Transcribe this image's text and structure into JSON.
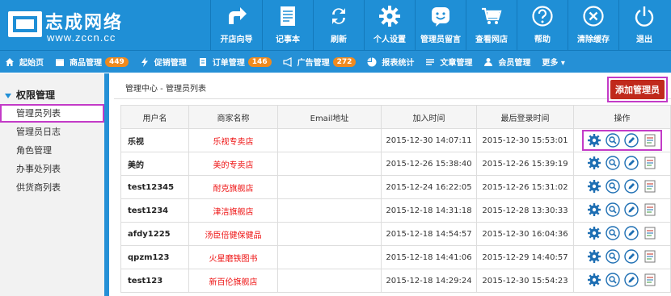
{
  "brand": {
    "title": "志成网络",
    "url": "www.zccn.cc"
  },
  "topnav": [
    {
      "label": "开店向导",
      "icon": "arrow-forward-icon"
    },
    {
      "label": "记事本",
      "icon": "notepad-icon"
    },
    {
      "label": "刷新",
      "icon": "refresh-icon"
    },
    {
      "label": "个人设置",
      "icon": "gear-icon"
    },
    {
      "label": "管理员留言",
      "icon": "smiley-chat-icon"
    },
    {
      "label": "查看网店",
      "icon": "cart-icon"
    },
    {
      "label": "帮助",
      "icon": "help-icon"
    },
    {
      "label": "清除缓存",
      "icon": "clear-icon"
    },
    {
      "label": "退出",
      "icon": "power-icon"
    }
  ],
  "subnav": [
    {
      "label": "起始页",
      "icon": "home-icon",
      "badge": ""
    },
    {
      "label": "商品管理",
      "icon": "box-icon",
      "badge": "449"
    },
    {
      "label": "促销管理",
      "icon": "lightning-icon",
      "badge": ""
    },
    {
      "label": "订单管理",
      "icon": "order-icon",
      "badge": "146"
    },
    {
      "label": "广告管理",
      "icon": "megaphone-icon",
      "badge": "272"
    },
    {
      "label": "报表统计",
      "icon": "pie-icon",
      "badge": ""
    },
    {
      "label": "文章管理",
      "icon": "list-icon",
      "badge": ""
    },
    {
      "label": "会员管理",
      "icon": "user-icon",
      "badge": ""
    },
    {
      "label": "更多 ▾",
      "icon": "",
      "badge": ""
    }
  ],
  "sidebar": {
    "heading": "权限管理",
    "items": [
      {
        "label": "管理员列表",
        "active": true
      },
      {
        "label": "管理员日志",
        "active": false
      },
      {
        "label": "角色管理",
        "active": false
      },
      {
        "label": "办事处列表",
        "active": false
      },
      {
        "label": "供货商列表",
        "active": false
      }
    ]
  },
  "breadcrumb": "管理中心 - 管理员列表",
  "add_button": "添加管理员",
  "table": {
    "headers": [
      "用户名",
      "商家名称",
      "Email地址",
      "加入时间",
      "最后登录时间",
      "操作"
    ],
    "rows": [
      {
        "user": "乐视",
        "shop": "乐视专卖店",
        "email": "",
        "joined": "2015-12-30 14:07:11",
        "last": "2015-12-30 15:53:01"
      },
      {
        "user": "美的",
        "shop": "美的专卖店",
        "email": "",
        "joined": "2015-12-26 15:38:40",
        "last": "2015-12-26 15:39:19"
      },
      {
        "user": "test12345",
        "shop": "耐克旗舰店",
        "email": "",
        "joined": "2015-12-24 16:22:05",
        "last": "2015-12-26 15:31:02"
      },
      {
        "user": "test1234",
        "shop": "津洁旗舰店",
        "email": "",
        "joined": "2015-12-18 14:31:18",
        "last": "2015-12-28 13:30:33"
      },
      {
        "user": "afdy1225",
        "shop": "汤臣倍健保健品",
        "email": "",
        "joined": "2015-12-18 14:54:57",
        "last": "2015-12-30 16:04:36"
      },
      {
        "user": "qpzm123",
        "shop": "火星磨铁图书",
        "email": "",
        "joined": "2015-12-18 14:41:06",
        "last": "2015-12-29 14:40:57"
      },
      {
        "user": "test123",
        "shop": "新百伦旗舰店",
        "email": "",
        "joined": "2015-12-18 14:29:24",
        "last": "2015-12-30 15:54:23"
      }
    ]
  },
  "colors": {
    "header": "#1f8fd6",
    "badge": "#f08a1e",
    "shop_text": "#ee1111",
    "highlight": "#c33bc7",
    "add_btn": "#c0291c"
  }
}
